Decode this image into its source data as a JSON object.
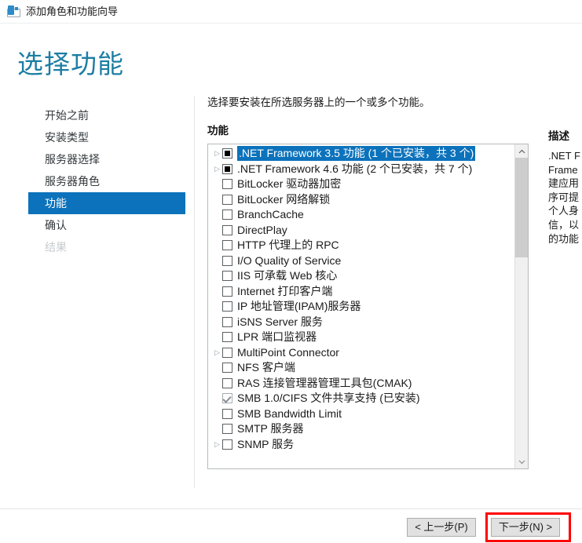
{
  "window": {
    "title": "添加角色和功能向导",
    "icon": "server-wizard-icon"
  },
  "page": {
    "title": "选择功能"
  },
  "sidebar": {
    "items": [
      {
        "label": "开始之前",
        "state": "normal"
      },
      {
        "label": "安装类型",
        "state": "normal"
      },
      {
        "label": "服务器选择",
        "state": "normal"
      },
      {
        "label": "服务器角色",
        "state": "normal"
      },
      {
        "label": "功能",
        "state": "selected"
      },
      {
        "label": "确认",
        "state": "normal"
      },
      {
        "label": "结果",
        "state": "disabled"
      }
    ],
    "selected_color": "#0c72bb"
  },
  "main": {
    "instruction": "选择要安装在所选服务器上的一个或多个功能。",
    "column_header": "功能",
    "features": [
      {
        "label": ".NET Framework 3.5 功能 (1 个已安装，共 3 个)",
        "checkbox": "partial",
        "expander": true,
        "selected": true
      },
      {
        "label": ".NET Framework 4.6 功能 (2 个已安装，共 7 个)",
        "checkbox": "partial",
        "expander": true,
        "selected": false
      },
      {
        "label": "BitLocker 驱动器加密",
        "checkbox": "unchecked",
        "expander": false,
        "selected": false
      },
      {
        "label": "BitLocker 网络解锁",
        "checkbox": "unchecked",
        "expander": false,
        "selected": false
      },
      {
        "label": "BranchCache",
        "checkbox": "unchecked",
        "expander": false,
        "selected": false
      },
      {
        "label": "DirectPlay",
        "checkbox": "unchecked",
        "expander": false,
        "selected": false
      },
      {
        "label": "HTTP 代理上的 RPC",
        "checkbox": "unchecked",
        "expander": false,
        "selected": false
      },
      {
        "label": "I/O Quality of Service",
        "checkbox": "unchecked",
        "expander": false,
        "selected": false
      },
      {
        "label": "IIS 可承载 Web 核心",
        "checkbox": "unchecked",
        "expander": false,
        "selected": false
      },
      {
        "label": "Internet 打印客户端",
        "checkbox": "unchecked",
        "expander": false,
        "selected": false
      },
      {
        "label": "IP 地址管理(IPAM)服务器",
        "checkbox": "unchecked",
        "expander": false,
        "selected": false
      },
      {
        "label": "iSNS Server 服务",
        "checkbox": "unchecked",
        "expander": false,
        "selected": false
      },
      {
        "label": "LPR 端口监视器",
        "checkbox": "unchecked",
        "expander": false,
        "selected": false
      },
      {
        "label": "MultiPoint Connector",
        "checkbox": "unchecked",
        "expander": true,
        "selected": false
      },
      {
        "label": "NFS 客户端",
        "checkbox": "unchecked",
        "expander": false,
        "selected": false
      },
      {
        "label": "RAS 连接管理器管理工具包(CMAK)",
        "checkbox": "unchecked",
        "expander": false,
        "selected": false
      },
      {
        "label": "SMB 1.0/CIFS 文件共享支持 (已安装)",
        "checkbox": "installed",
        "expander": false,
        "selected": false
      },
      {
        "label": "SMB Bandwidth Limit",
        "checkbox": "unchecked",
        "expander": false,
        "selected": false
      },
      {
        "label": "SMTP 服务器",
        "checkbox": "unchecked",
        "expander": false,
        "selected": false
      },
      {
        "label": "SNMP 服务",
        "checkbox": "unchecked",
        "expander": true,
        "selected": false
      }
    ]
  },
  "description": {
    "title": "描述",
    "lines": [
      ".NET F",
      "Frame",
      "建应用",
      "序可提",
      "个人身",
      "信，以",
      "的功能"
    ]
  },
  "footer": {
    "previous_label": "< 上一步(P)",
    "next_label": "下一步(N) >",
    "highlight_color": "#ff0000"
  }
}
